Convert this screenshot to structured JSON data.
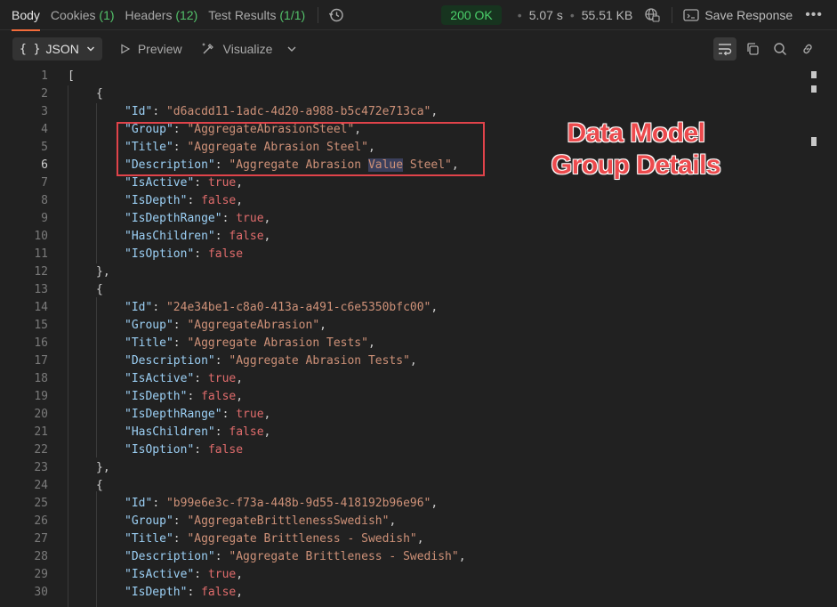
{
  "tabs": [
    {
      "label": "Body",
      "count": ""
    },
    {
      "label": "Cookies",
      "count": "(1)"
    },
    {
      "label": "Headers",
      "count": "(12)"
    },
    {
      "label": "Test Results",
      "count": "(1/1)"
    }
  ],
  "status": {
    "code": "200 OK",
    "time": "5.07 s",
    "size": "55.51 KB"
  },
  "save_response": "Save Response",
  "toolbar": {
    "format": "JSON",
    "preview": "Preview",
    "visualize": "Visualize"
  },
  "annotation": {
    "line1": "Data Model",
    "line2": "Group Details"
  },
  "colors": {
    "accent": "#f26b3a",
    "ok": "#4bd06b",
    "annotation": "#ec4a4d"
  },
  "lines": [
    {
      "n": "1",
      "indent": 0,
      "tokens": [
        {
          "t": "[",
          "c": "p"
        }
      ]
    },
    {
      "n": "2",
      "indent": 1,
      "tokens": [
        {
          "t": "{",
          "c": "p"
        }
      ]
    },
    {
      "n": "3",
      "indent": 2,
      "tokens": [
        {
          "t": "\"Id\"",
          "c": "k"
        },
        {
          "t": ": ",
          "c": "p"
        },
        {
          "t": "\"d6acdd11-1adc-4d20-a988-b5c472e713ca\"",
          "c": "s"
        },
        {
          "t": ",",
          "c": "p"
        }
      ]
    },
    {
      "n": "4",
      "indent": 2,
      "tokens": [
        {
          "t": "\"Group\"",
          "c": "k"
        },
        {
          "t": ": ",
          "c": "p"
        },
        {
          "t": "\"AggregateAbrasionSteel\"",
          "c": "s"
        },
        {
          "t": ",",
          "c": "p"
        }
      ]
    },
    {
      "n": "5",
      "indent": 2,
      "tokens": [
        {
          "t": "\"Title\"",
          "c": "k"
        },
        {
          "t": ": ",
          "c": "p"
        },
        {
          "t": "\"Aggregate Abrasion Steel\"",
          "c": "s"
        },
        {
          "t": ",",
          "c": "p"
        }
      ]
    },
    {
      "n": "6",
      "indent": 2,
      "cur": true,
      "tokens": [
        {
          "t": "\"Description\"",
          "c": "k"
        },
        {
          "t": ": ",
          "c": "p"
        },
        {
          "t": "\"Aggregate Abrasion ",
          "c": "s"
        },
        {
          "t": "Value",
          "c": "s hlword"
        },
        {
          "t": " Steel\"",
          "c": "s"
        },
        {
          "t": ",",
          "c": "p"
        }
      ]
    },
    {
      "n": "7",
      "indent": 2,
      "tokens": [
        {
          "t": "\"IsActive\"",
          "c": "k"
        },
        {
          "t": ": ",
          "c": "p"
        },
        {
          "t": "true",
          "c": "b"
        },
        {
          "t": ",",
          "c": "p"
        }
      ]
    },
    {
      "n": "8",
      "indent": 2,
      "tokens": [
        {
          "t": "\"IsDepth\"",
          "c": "k"
        },
        {
          "t": ": ",
          "c": "p"
        },
        {
          "t": "false",
          "c": "b"
        },
        {
          "t": ",",
          "c": "p"
        }
      ]
    },
    {
      "n": "9",
      "indent": 2,
      "tokens": [
        {
          "t": "\"IsDepthRange\"",
          "c": "k"
        },
        {
          "t": ": ",
          "c": "p"
        },
        {
          "t": "true",
          "c": "b"
        },
        {
          "t": ",",
          "c": "p"
        }
      ]
    },
    {
      "n": "10",
      "indent": 2,
      "tokens": [
        {
          "t": "\"HasChildren\"",
          "c": "k"
        },
        {
          "t": ": ",
          "c": "p"
        },
        {
          "t": "false",
          "c": "b"
        },
        {
          "t": ",",
          "c": "p"
        }
      ]
    },
    {
      "n": "11",
      "indent": 2,
      "tokens": [
        {
          "t": "\"IsOption\"",
          "c": "k"
        },
        {
          "t": ": ",
          "c": "p"
        },
        {
          "t": "false",
          "c": "b"
        }
      ]
    },
    {
      "n": "12",
      "indent": 1,
      "tokens": [
        {
          "t": "},",
          "c": "p"
        }
      ]
    },
    {
      "n": "13",
      "indent": 1,
      "tokens": [
        {
          "t": "{",
          "c": "p"
        }
      ]
    },
    {
      "n": "14",
      "indent": 2,
      "tokens": [
        {
          "t": "\"Id\"",
          "c": "k"
        },
        {
          "t": ": ",
          "c": "p"
        },
        {
          "t": "\"24e34be1-c8a0-413a-a491-c6e5350bfc00\"",
          "c": "s"
        },
        {
          "t": ",",
          "c": "p"
        }
      ]
    },
    {
      "n": "15",
      "indent": 2,
      "tokens": [
        {
          "t": "\"Group\"",
          "c": "k"
        },
        {
          "t": ": ",
          "c": "p"
        },
        {
          "t": "\"AggregateAbrasion\"",
          "c": "s"
        },
        {
          "t": ",",
          "c": "p"
        }
      ]
    },
    {
      "n": "16",
      "indent": 2,
      "tokens": [
        {
          "t": "\"Title\"",
          "c": "k"
        },
        {
          "t": ": ",
          "c": "p"
        },
        {
          "t": "\"Aggregate Abrasion Tests\"",
          "c": "s"
        },
        {
          "t": ",",
          "c": "p"
        }
      ]
    },
    {
      "n": "17",
      "indent": 2,
      "tokens": [
        {
          "t": "\"Description\"",
          "c": "k"
        },
        {
          "t": ": ",
          "c": "p"
        },
        {
          "t": "\"Aggregate Abrasion Tests\"",
          "c": "s"
        },
        {
          "t": ",",
          "c": "p"
        }
      ]
    },
    {
      "n": "18",
      "indent": 2,
      "tokens": [
        {
          "t": "\"IsActive\"",
          "c": "k"
        },
        {
          "t": ": ",
          "c": "p"
        },
        {
          "t": "true",
          "c": "b"
        },
        {
          "t": ",",
          "c": "p"
        }
      ]
    },
    {
      "n": "19",
      "indent": 2,
      "tokens": [
        {
          "t": "\"IsDepth\"",
          "c": "k"
        },
        {
          "t": ": ",
          "c": "p"
        },
        {
          "t": "false",
          "c": "b"
        },
        {
          "t": ",",
          "c": "p"
        }
      ]
    },
    {
      "n": "20",
      "indent": 2,
      "tokens": [
        {
          "t": "\"IsDepthRange\"",
          "c": "k"
        },
        {
          "t": ": ",
          "c": "p"
        },
        {
          "t": "true",
          "c": "b"
        },
        {
          "t": ",",
          "c": "p"
        }
      ]
    },
    {
      "n": "21",
      "indent": 2,
      "tokens": [
        {
          "t": "\"HasChildren\"",
          "c": "k"
        },
        {
          "t": ": ",
          "c": "p"
        },
        {
          "t": "false",
          "c": "b"
        },
        {
          "t": ",",
          "c": "p"
        }
      ]
    },
    {
      "n": "22",
      "indent": 2,
      "tokens": [
        {
          "t": "\"IsOption\"",
          "c": "k"
        },
        {
          "t": ": ",
          "c": "p"
        },
        {
          "t": "false",
          "c": "b"
        }
      ]
    },
    {
      "n": "23",
      "indent": 1,
      "tokens": [
        {
          "t": "},",
          "c": "p"
        }
      ]
    },
    {
      "n": "24",
      "indent": 1,
      "tokens": [
        {
          "t": "{",
          "c": "p"
        }
      ]
    },
    {
      "n": "25",
      "indent": 2,
      "tokens": [
        {
          "t": "\"Id\"",
          "c": "k"
        },
        {
          "t": ": ",
          "c": "p"
        },
        {
          "t": "\"b99e6e3c-f73a-448b-9d55-418192b96e96\"",
          "c": "s"
        },
        {
          "t": ",",
          "c": "p"
        }
      ]
    },
    {
      "n": "26",
      "indent": 2,
      "tokens": [
        {
          "t": "\"Group\"",
          "c": "k"
        },
        {
          "t": ": ",
          "c": "p"
        },
        {
          "t": "\"AggregateBrittlenessSwedish\"",
          "c": "s"
        },
        {
          "t": ",",
          "c": "p"
        }
      ]
    },
    {
      "n": "27",
      "indent": 2,
      "tokens": [
        {
          "t": "\"Title\"",
          "c": "k"
        },
        {
          "t": ": ",
          "c": "p"
        },
        {
          "t": "\"Aggregate Brittleness - Swedish\"",
          "c": "s"
        },
        {
          "t": ",",
          "c": "p"
        }
      ]
    },
    {
      "n": "28",
      "indent": 2,
      "tokens": [
        {
          "t": "\"Description\"",
          "c": "k"
        },
        {
          "t": ": ",
          "c": "p"
        },
        {
          "t": "\"Aggregate Brittleness - Swedish\"",
          "c": "s"
        },
        {
          "t": ",",
          "c": "p"
        }
      ]
    },
    {
      "n": "29",
      "indent": 2,
      "tokens": [
        {
          "t": "\"IsActive\"",
          "c": "k"
        },
        {
          "t": ": ",
          "c": "p"
        },
        {
          "t": "true",
          "c": "b"
        },
        {
          "t": ",",
          "c": "p"
        }
      ]
    },
    {
      "n": "30",
      "indent": 2,
      "tokens": [
        {
          "t": "\"IsDepth\"",
          "c": "k"
        },
        {
          "t": ": ",
          "c": "p"
        },
        {
          "t": "false",
          "c": "b"
        },
        {
          "t": ",",
          "c": "p"
        }
      ]
    }
  ]
}
